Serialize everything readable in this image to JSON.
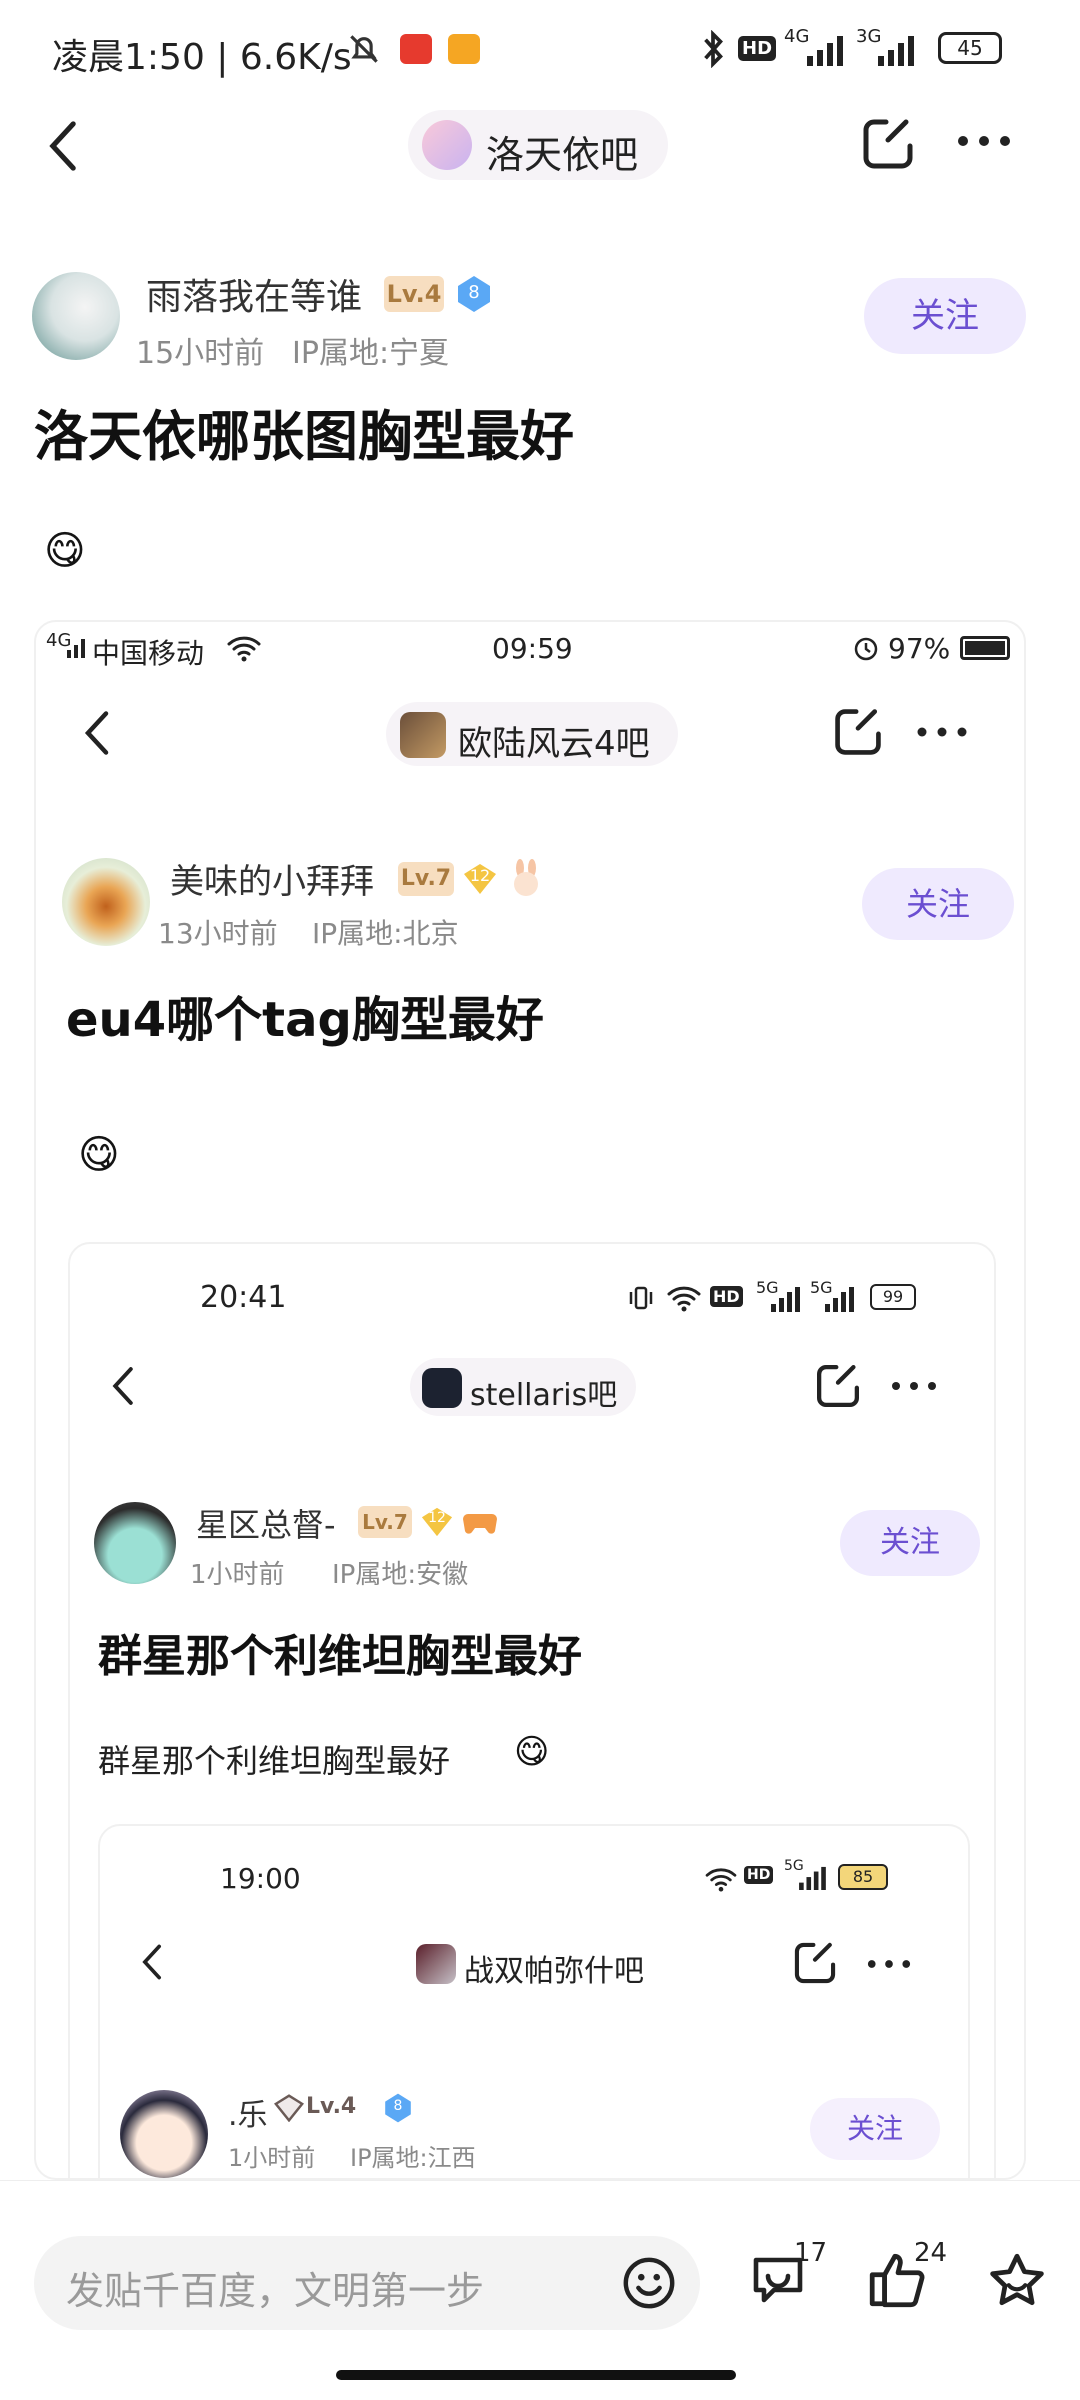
{
  "status_bar": {
    "time_text": "凌晨1:50 | 6.6K/s",
    "network_1": "4G",
    "network_2": "3G",
    "hd": "HD",
    "battery": "45"
  },
  "header": {
    "forum_name": "洛天依吧"
  },
  "post": {
    "author": "雨落我在等谁",
    "level": "Lv.4",
    "badge_num": "8",
    "time": "15小时前",
    "ip": "IP属地:宁夏",
    "follow": "关注",
    "title": "洛天依哪张图胸型最好",
    "emoji": "😋"
  },
  "screenshot1": {
    "carrier": "中国移动",
    "net": "4G",
    "time": "09:59",
    "battery": "97%",
    "forum_name": "欧陆风云4吧",
    "author": "美味的小拜拜",
    "level": "Lv.7",
    "badge_num": "12",
    "post_time": "13小时前",
    "ip": "IP属地:北京",
    "follow": "关注",
    "title": "eu4哪个tag胸型最好",
    "emoji": "😋"
  },
  "screenshot2": {
    "time": "20:41",
    "hd": "HD",
    "net1": "5G",
    "net2": "5G",
    "battery": "99",
    "forum_name": "stellaris吧",
    "author": "星区总督-",
    "level": "Lv.7",
    "badge_num": "12",
    "post_time": "1小时前",
    "ip": "IP属地:安徽",
    "follow": "关注",
    "title": "群星那个利维坦胸型最好",
    "body": "群星那个利维坦胸型最好",
    "emoji": "😋"
  },
  "screenshot3": {
    "time": "19:00",
    "hd": "HD",
    "net": "5G",
    "battery": "85",
    "forum_name": "战双帕弥什吧",
    "author": ".乐",
    "level": "Lv.4",
    "badge_num": "8",
    "post_time": "1小时前",
    "ip": "IP属地:江西",
    "follow": "关注"
  },
  "bottom_bar": {
    "input_placeholder": "发贴千百度，文明第一步",
    "comment_count": "17",
    "like_count": "24"
  },
  "colors": {
    "accent": "#6b4fd1",
    "follow_bg": "#efeafe",
    "level_bg": "#f7dec0",
    "badge_blue": "#5aa8f5"
  }
}
